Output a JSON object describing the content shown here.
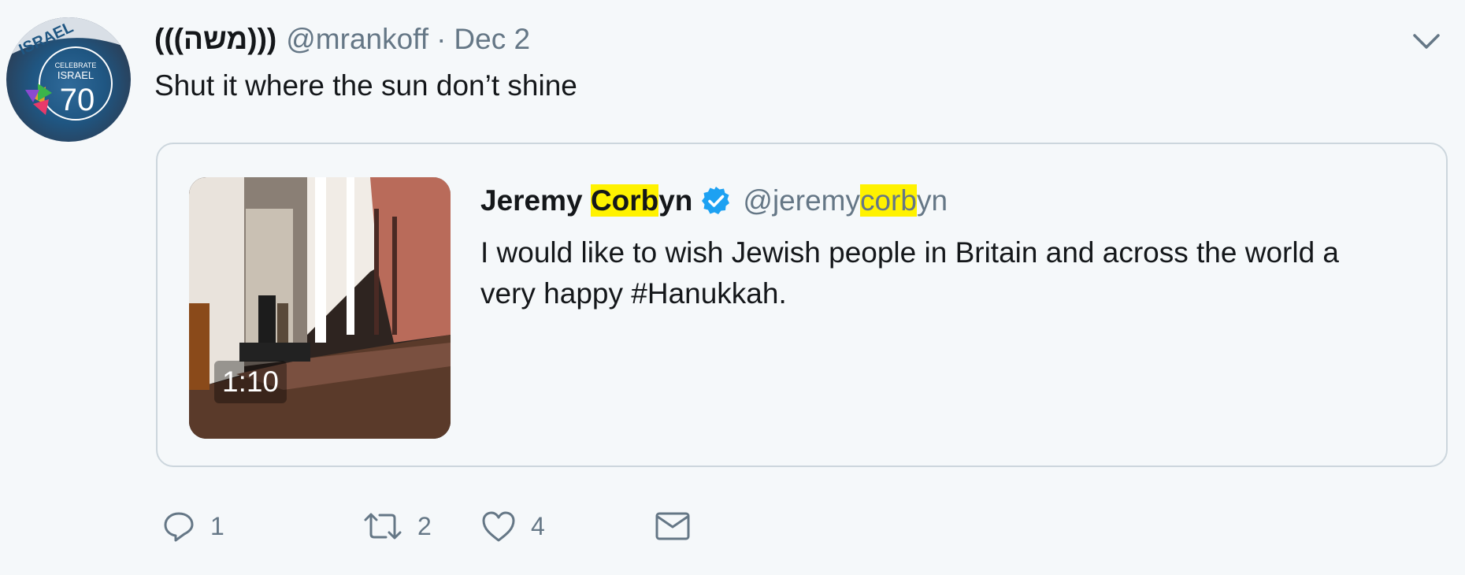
{
  "tweet": {
    "display_name": "(((משה)))",
    "handle": "@mrankoff",
    "separator": "·",
    "date": "Dec 2",
    "text": "Shut it where the sun don’t shine"
  },
  "avatar": {
    "line1": "CELEBRATE",
    "line2": "ISRAEL",
    "number": "70",
    "banner": "ISRAEL"
  },
  "quoted": {
    "name_pre": "Jeremy ",
    "name_hl": "Corb",
    "name_post": "yn",
    "handle_pre": "@jeremy",
    "handle_hl": "corb",
    "handle_post": "yn",
    "text": "I would like to wish Jewish people in Britain and across the world a very happy #Hanukkah.",
    "video_duration": "1:10",
    "highlight_color": "#fff200"
  },
  "actions": {
    "reply_count": "1",
    "retweet_count": "2",
    "like_count": "4"
  },
  "icons": {
    "caret": "chevron-down-icon",
    "verified": "verified-badge-icon",
    "reply": "reply-icon",
    "retweet": "retweet-icon",
    "like": "heart-icon",
    "dm": "envelope-icon"
  },
  "colors": {
    "background": "#f5f8fa",
    "text": "#14171a",
    "secondary": "#657786",
    "border": "#ccd6dd",
    "verified": "#1da1f2"
  }
}
